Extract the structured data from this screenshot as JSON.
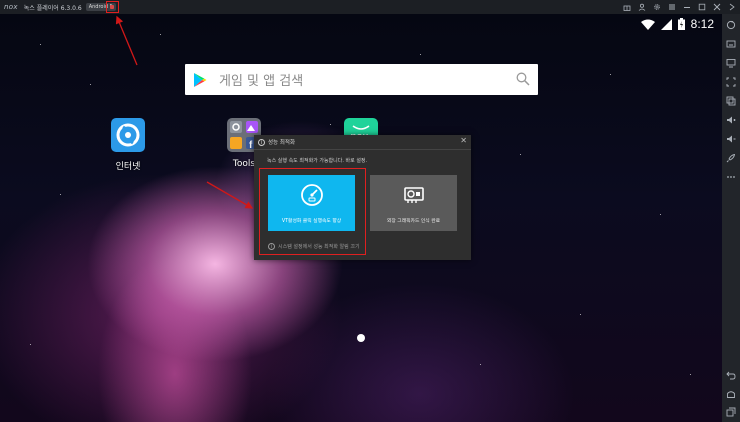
{
  "titlebar": {
    "logo": "nox",
    "title": "녹스 플레이어 6.3.0.6",
    "badge": "Android 5"
  },
  "status": {
    "time": "8:12"
  },
  "search": {
    "placeholder": "게임 및 앱 검색"
  },
  "apps": [
    {
      "label": "인터넷",
      "icon": "internet-browser-icon"
    },
    {
      "label": "Tools",
      "icon": "tools-folder-icon"
    },
    {
      "label": "",
      "icon": "nox-app-icon"
    }
  ],
  "dialog": {
    "title": "성능 최적화",
    "message": "녹스 실행 속도 최적화가 가능합니다. 바로 설정.",
    "option_vt": "VT활성화 클릭 실행속도 향상",
    "option_gpu": "외장 그래픽카드 인식 완료",
    "footer": "시스템 설정에서 성능 최적화 알림 끄기"
  },
  "colors": {
    "vt_option_bg": "#0fb7ef",
    "gpu_option_bg": "#5a5a5a",
    "highlight_red": "#e02020"
  }
}
